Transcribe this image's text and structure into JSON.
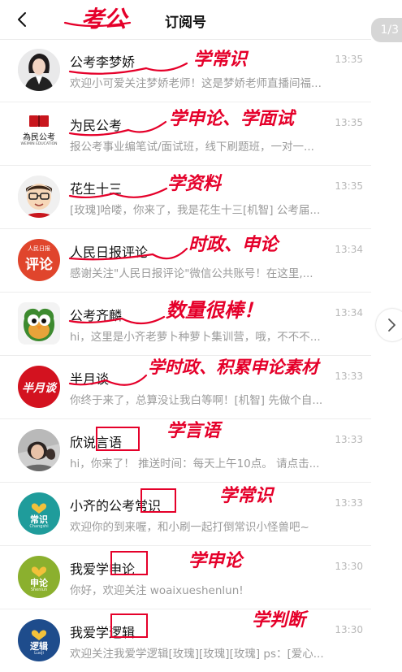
{
  "header": {
    "title": "订阅号",
    "page_indicator": "1/3"
  },
  "items": [
    {
      "name": "公考李梦娇",
      "time": "13:35",
      "preview": "欢迎小可爱关注梦娇老师！这是梦娇老师直播间福...",
      "annotation": "学常识"
    },
    {
      "name": "为民公考",
      "time": "13:35",
      "preview": "报公考事业编笔试/面试班，线下刷题班，一对一...",
      "annotation": "学申论、学面试"
    },
    {
      "name": "花生十三",
      "time": "13:35",
      "preview": "[玫瑰]哈喽，你来了，我是花生十三[机智] 公考届...",
      "annotation": "学资料"
    },
    {
      "name": "人民日报评论",
      "time": "13:34",
      "preview": "感谢关注\"人民日报评论\"微信公共账号！在这里,...",
      "annotation": "时政、申论"
    },
    {
      "name": "公考齐麟",
      "time": "13:34",
      "preview": "hi，这里是小齐老萝卜种萝卜集训营，哦，不不不...",
      "annotation": "数量很棒！"
    },
    {
      "name": "半月谈",
      "time": "13:33",
      "preview": "你终于来了，总算没让我白等啊！[机智] 先做个自...",
      "annotation": "学时政、积累申论素材"
    },
    {
      "name": "欣说言语",
      "time": "13:33",
      "preview": "hi，你来了！ 推送时间：每天上午10点。 请点击...",
      "annotation": "学言语"
    },
    {
      "name": "小齐的公考常识",
      "time": "13:33",
      "preview": "欢迎你的到来喔，和小刷一起打倒常识小怪兽吧~",
      "annotation": "学常识"
    },
    {
      "name": "我爱学申论",
      "time": "13:30",
      "preview": "你好，欢迎关注 woaixueshenlun!",
      "annotation": "学申论"
    },
    {
      "name": "我爱学逻辑",
      "time": "13:30",
      "preview": "欢迎关注我爱学逻辑[玫瑰][玫瑰][玫瑰] ps：[爱心...",
      "annotation": "学判断"
    }
  ],
  "overlay": {
    "title_annotation": "考公"
  },
  "avatars": {
    "weimin_logo_text": "為民公考",
    "weimin_logo_sub": "WEIMIN EDUCATION",
    "renmin_logo_text": "评论",
    "renmin_logo_top": "人民日报",
    "banyuetan_logo_text": "半月谈",
    "changshi_logo_text": "常识",
    "changshi_logo_sub": "Changshi",
    "shenlun_logo_text": "申论",
    "shenlun_logo_sub": "Shenlun",
    "luoji_logo_text": "逻辑",
    "luoji_logo_sub": "Luoji"
  },
  "colors": {
    "ink_red": "#e5002a",
    "renmin_red": "#e0452c",
    "banyuetan_red": "#d3121f",
    "teal": "#1f9c9b",
    "olive": "#8bb02e",
    "navy": "#1e4c8c"
  }
}
